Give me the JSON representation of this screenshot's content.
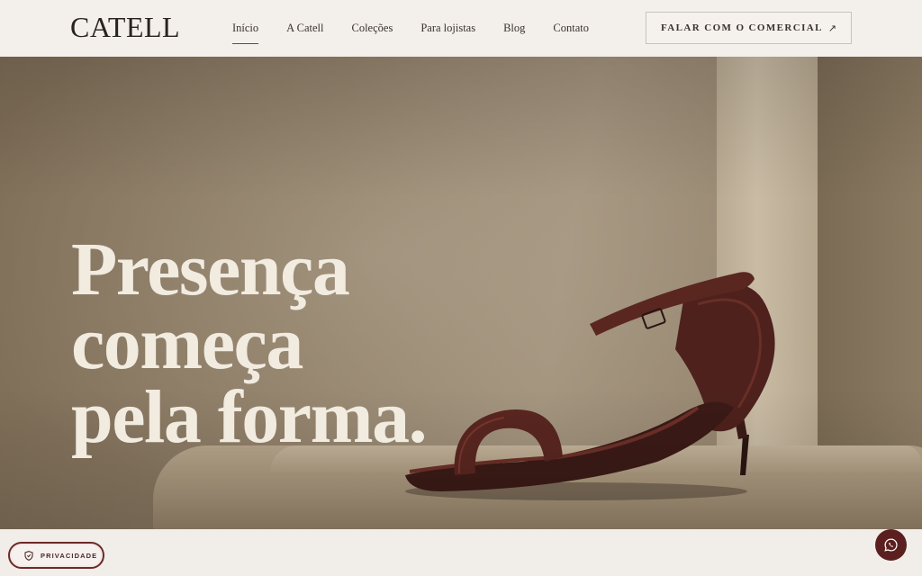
{
  "brand": {
    "logo_text": "CATELL"
  },
  "nav": {
    "items": [
      {
        "label": "Início",
        "active": true
      },
      {
        "label": "A Catell",
        "active": false
      },
      {
        "label": "Coleções",
        "active": false
      },
      {
        "label": "Para lojistas",
        "active": false
      },
      {
        "label": "Blog",
        "active": false
      },
      {
        "label": "Contato",
        "active": false
      }
    ]
  },
  "cta": {
    "label": "FALAR COM O COMERCIAL",
    "icon": "arrow-up-right-icon"
  },
  "hero": {
    "headline_lines": [
      "Presença",
      "começa",
      "pela forma."
    ],
    "image": "burgundy-ankle-strap-sandal-on-stone"
  },
  "privacy": {
    "label": "PRIVACIDADE",
    "icon": "shield-icon"
  },
  "whatsapp": {
    "icon": "whatsapp-icon"
  },
  "colors": {
    "accent": "#5c1f1f",
    "header_bg": "#f3f0eb",
    "headline": "#f1ebe0"
  }
}
